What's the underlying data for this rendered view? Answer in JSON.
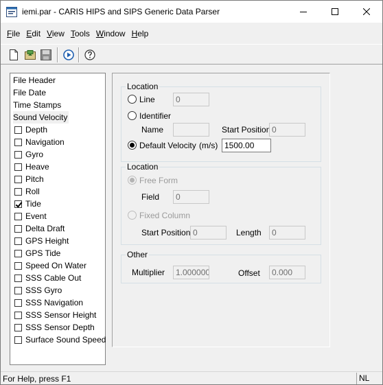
{
  "window": {
    "title": "iemi.par - CARIS HIPS and SIPS Generic Data Parser"
  },
  "menu": [
    {
      "key": "F",
      "rest": "ile"
    },
    {
      "key": "E",
      "rest": "dit"
    },
    {
      "key": "V",
      "rest": "iew"
    },
    {
      "key": "T",
      "rest": "ools"
    },
    {
      "key": "W",
      "rest": "indow"
    },
    {
      "key": "H",
      "rest": "elp"
    }
  ],
  "toolbar": {
    "icons": [
      "new-file-icon",
      "open-icon",
      "save-icon",
      "run-icon",
      "help-icon"
    ]
  },
  "tree": {
    "headers": [
      "File Header",
      "File Date",
      "Time Stamps",
      "Sound Velocity"
    ],
    "selected": "Sound Velocity",
    "items": [
      {
        "label": "Depth",
        "checked": false
      },
      {
        "label": "Navigation",
        "checked": false
      },
      {
        "label": "Gyro",
        "checked": false
      },
      {
        "label": "Heave",
        "checked": false
      },
      {
        "label": "Pitch",
        "checked": false
      },
      {
        "label": "Roll",
        "checked": false
      },
      {
        "label": "Tide",
        "checked": true
      },
      {
        "label": "Event",
        "checked": false
      },
      {
        "label": "Delta Draft",
        "checked": false
      },
      {
        "label": "GPS Height",
        "checked": false
      },
      {
        "label": "GPS Tide",
        "checked": false
      },
      {
        "label": "Speed On Water",
        "checked": false
      },
      {
        "label": "SSS Cable Out",
        "checked": false
      },
      {
        "label": "SSS Gyro",
        "checked": false
      },
      {
        "label": "SSS Navigation",
        "checked": false
      },
      {
        "label": "SSS Sensor Height",
        "checked": false
      },
      {
        "label": "SSS Sensor Depth",
        "checked": false
      },
      {
        "label": "Surface Sound Speed",
        "checked": false
      }
    ]
  },
  "location1": {
    "title": "Location",
    "line_label": "Line",
    "line_value": "0",
    "identifier_label": "Identifier",
    "name_label": "Name",
    "name_value": "",
    "start_position_label": "Start Position",
    "start_position_value": "0",
    "default_velocity_label": "Default Velocity",
    "units_label": "(m/s)",
    "default_velocity_value": "1500.00",
    "selected": "Default Velocity"
  },
  "location2": {
    "title": "Location",
    "free_form_label": "Free Form",
    "field_label": "Field",
    "field_value": "0",
    "fixed_column_label": "Fixed Column",
    "start_position_label": "Start Position",
    "start_position_value": "0",
    "length_label": "Length",
    "length_value": "0"
  },
  "other": {
    "title": "Other",
    "multiplier_label": "Multiplier",
    "multiplier_value": "1.000000",
    "offset_label": "Offset",
    "offset_value": "0.000"
  },
  "status": {
    "text": "For Help, press F1",
    "indicator": "NL"
  }
}
